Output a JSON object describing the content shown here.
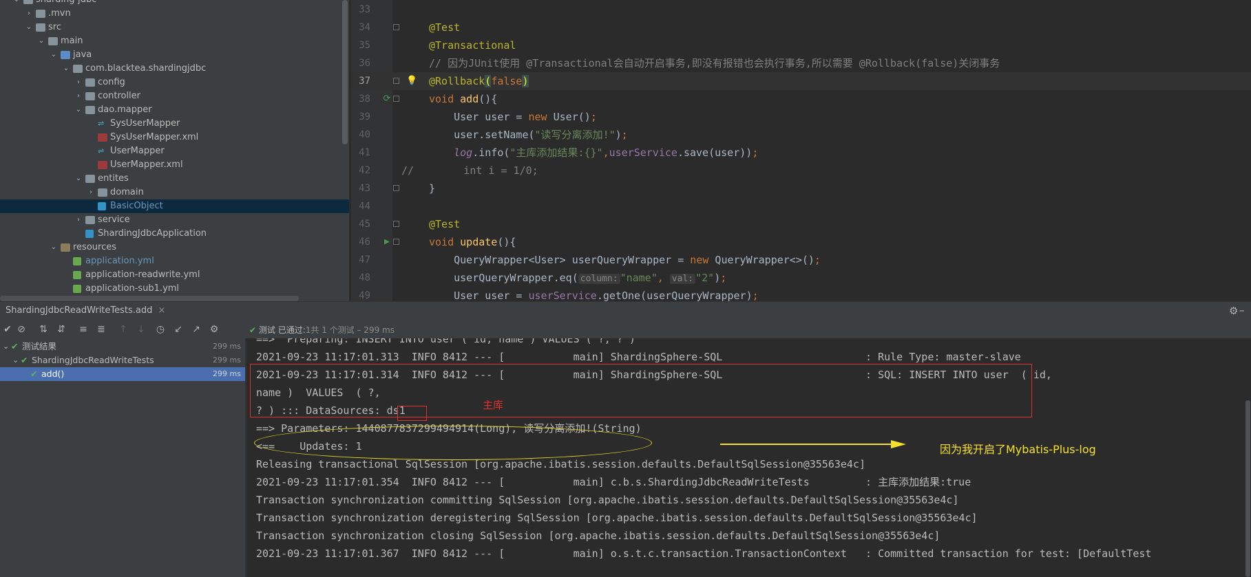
{
  "tree": {
    "rows": [
      {
        "label": "sharding-jdbc",
        "icon": "folder",
        "depth": 0,
        "arrow": "v"
      },
      {
        "label": ".mvn",
        "icon": "folder",
        "depth": 1,
        "arrow": ">"
      },
      {
        "label": "src",
        "icon": "folder",
        "depth": 1,
        "arrow": "v"
      },
      {
        "label": "main",
        "icon": "folder",
        "depth": 2,
        "arrow": "v"
      },
      {
        "label": "java",
        "icon": "srcfolder",
        "depth": 3,
        "arrow": "v"
      },
      {
        "label": "com.blacktea.shardingjdbc",
        "icon": "folder",
        "depth": 4,
        "arrow": "v"
      },
      {
        "label": "config",
        "icon": "folder",
        "depth": 5,
        "arrow": ">"
      },
      {
        "label": "controller",
        "icon": "folder",
        "depth": 5,
        "arrow": ">"
      },
      {
        "label": "dao.mapper",
        "icon": "folder",
        "depth": 5,
        "arrow": "v"
      },
      {
        "label": "SysUserMapper",
        "icon": "mapper",
        "depth": 6,
        "arrow": ""
      },
      {
        "label": "SysUserMapper.xml",
        "icon": "xml",
        "depth": 6,
        "arrow": ""
      },
      {
        "label": "UserMapper",
        "icon": "mapper",
        "depth": 6,
        "arrow": ""
      },
      {
        "label": "UserMapper.xml",
        "icon": "xml",
        "depth": 6,
        "arrow": ""
      },
      {
        "label": "entites",
        "icon": "folder",
        "depth": 5,
        "arrow": "v"
      },
      {
        "label": "domain",
        "icon": "folder",
        "depth": 6,
        "arrow": ">"
      },
      {
        "label": "BasicObject",
        "icon": "class",
        "depth": 6,
        "arrow": "",
        "selected": true
      },
      {
        "label": "service",
        "icon": "folder",
        "depth": 5,
        "arrow": ">"
      },
      {
        "label": "ShardingJdbcApplication",
        "icon": "app",
        "depth": 5,
        "arrow": ""
      },
      {
        "label": "resources",
        "icon": "res",
        "depth": 3,
        "arrow": "v"
      },
      {
        "label": "application.yml",
        "icon": "yml",
        "depth": 4,
        "arrow": "",
        "blue": true
      },
      {
        "label": "application-readwrite.yml",
        "icon": "yml",
        "depth": 4,
        "arrow": ""
      },
      {
        "label": "application-sub1.yml",
        "icon": "yml",
        "depth": 4,
        "arrow": ""
      },
      {
        "label": "application-sub2.yml",
        "icon": "yml",
        "depth": 4,
        "arrow": ""
      }
    ]
  },
  "editor": {
    "lines": [
      {
        "num": "33",
        "html": ""
      },
      {
        "num": "34",
        "html": "<span class='ann'>@Test</span>",
        "fold": true
      },
      {
        "num": "35",
        "html": "<span class='ann'>@Transactional</span>"
      },
      {
        "num": "36",
        "html": "<span class='cm'>// 因为JUnit使用 @Transactional会自动开启事务,即没有报错也会执行事务,所以需要 @Rollback(false)关闭事务</span>"
      },
      {
        "num": "37",
        "html": "<span class='ann'>@Rollback</span><span class='paren-hl'>(</span><span class='k'>false</span><span class='paren-hl'>)</span>",
        "current": true,
        "bulb": true,
        "fold": true
      },
      {
        "num": "38",
        "html": "<span class='k'>void </span><span class='fn'>add</span><span class='plain'>(){</span>",
        "run": "recycle",
        "fold": true
      },
      {
        "num": "39",
        "html": "    <span class='plain'>User user = </span><span class='k'>new </span><span class='plain'>User()</span><span class='k'>;</span>"
      },
      {
        "num": "40",
        "html": "    <span class='plain'>user.setName(</span><span class='str'>\"读写分离添加!\"</span><span class='plain'>)</span><span class='k'>;</span>"
      },
      {
        "num": "41",
        "html": "    <span class='fld' style='font-style:italic'>log</span><span class='plain'>.info(</span><span class='str'>\"主库添加结果:{}\"</span><span class='k'>,</span><span class='fld'>userService</span><span class='plain'>.save(user))</span><span class='k'>;</span>"
      },
      {
        "num": "42",
        "html": "<span class='cm'>//        int i = 1/0;</span>",
        "commentAtGutter": true
      },
      {
        "num": "43",
        "html": "<span class='plain'>}</span>",
        "fold": true
      },
      {
        "num": "44",
        "html": ""
      },
      {
        "num": "45",
        "html": "<span class='ann'>@Test</span>",
        "fold": true
      },
      {
        "num": "46",
        "html": "<span class='k'>void </span><span class='fn'>update</span><span class='plain'>(){</span>",
        "run": "play",
        "fold": true
      },
      {
        "num": "47",
        "html": "    <span class='plain'>QueryWrapper&lt;User&gt; userQueryWrapper = </span><span class='k'>new </span><span class='plain'>QueryWrapper&lt;&gt;()</span><span class='k'>;</span>"
      },
      {
        "num": "48",
        "html": "    <span class='plain'>userQueryWrapper.eq(</span><span class='hint'>column:</span><span class='str'>\"name\"</span><span class='k'>, </span><span class='hint'>val:</span><span class='str'>\"2\"</span><span class='plain'>)</span><span class='k'>;</span>"
      },
      {
        "num": "49",
        "html": "    <span class='plain'>User user = </span><span class='fld'>userService</span><span class='plain'>.getOne(userQueryWrapper)</span><span class='k'>;</span>"
      }
    ]
  },
  "run_tab": {
    "label": "ShardingJdbcReadWriteTests.add",
    "close": "×"
  },
  "status": {
    "prefix": "测试",
    "passed": "已通过:",
    "count": "1共 1 个测试 – 299 ms"
  },
  "tests": [
    {
      "label": "测试结果",
      "time": "299 ms",
      "depth": 0,
      "arrow": "v"
    },
    {
      "label": "ShardingJdbcReadWriteTests",
      "time": "299 ms",
      "depth": 1,
      "arrow": "v"
    },
    {
      "label": "add()",
      "time": "299 ms",
      "depth": 2,
      "arrow": "",
      "selected": true
    }
  ],
  "console": {
    "lines": [
      "==>  Preparing: INSERT INTO user ( id, name ) VALUES ( ?, ? )",
      "2021-09-23 11:17:01.313  INFO 8412 --- [           main] ShardingSphere-SQL                       : Rule Type: master-slave",
      "2021-09-23 11:17:01.314  INFO 8412 --- [           main] ShardingSphere-SQL                       : SQL: INSERT INTO user  ( id,",
      "name )  VALUES  ( ?,",
      "? ) ::: DataSources: ds1",
      "==> Parameters: 1440877837299494914(Long), 读写分离添加!(String)",
      "<==    Updates: 1",
      "Releasing transactional SqlSession [org.apache.ibatis.session.defaults.DefaultSqlSession@35563e4c]",
      "2021-09-23 11:17:01.354  INFO 8412 --- [           main] c.b.s.ShardingJdbcReadWriteTests         : 主库添加结果:true",
      "Transaction synchronization committing SqlSession [org.apache.ibatis.session.defaults.DefaultSqlSession@35563e4c]",
      "Transaction synchronization deregistering SqlSession [org.apache.ibatis.session.defaults.DefaultSqlSession@35563e4c]",
      "Transaction synchronization closing SqlSession [org.apache.ibatis.session.defaults.DefaultSqlSession@35563e4c]",
      "2021-09-23 11:17:01.367  INFO 8412 --- [           main] o.s.t.c.transaction.TransactionContext   : Committed transaction for test: [DefaultTest"
    ],
    "annotation_red": "主库",
    "annotation_yellow": "因为我开启了Mybatis-Plus-log"
  },
  "toolbar_icons": [
    "rerun-icon",
    "stop-icon",
    "sort-alpha-icon",
    "sort-duration-icon",
    "expand-all-icon",
    "collapse-all-icon",
    "prev-failed-icon",
    "next-failed-icon",
    "history-icon",
    "import-icon",
    "export-icon",
    "settings-icon"
  ],
  "colors": {
    "accent_select": "#4b6eaf",
    "pass_green": "#5fb35f",
    "annotation_red": "#e0312c",
    "annotation_yellow": "#f5e12a"
  }
}
